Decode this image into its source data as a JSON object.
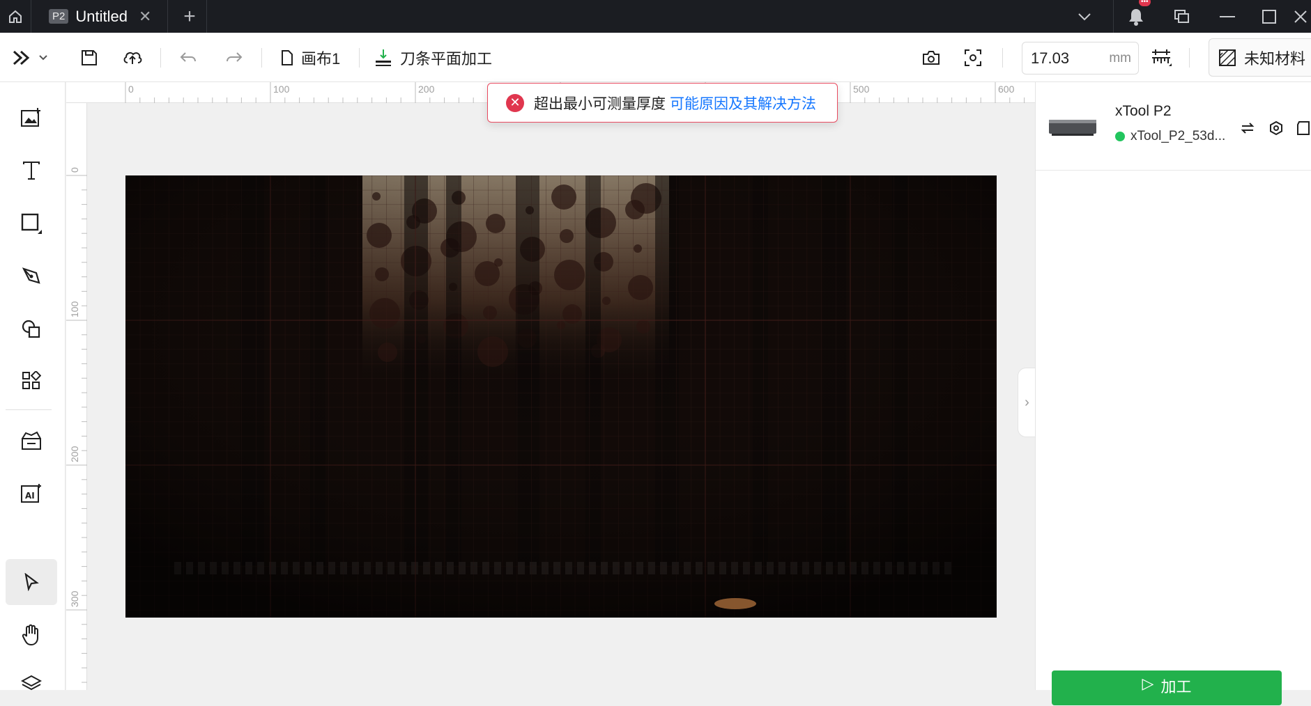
{
  "titlebar": {
    "tab_badge": "P2",
    "tab_title": "Untitled",
    "notification_count": "•••"
  },
  "toolbar": {
    "canvas_name": "画布1",
    "process_mode": "刀条平面加工",
    "thickness_value": "17.03",
    "thickness_unit": "mm",
    "material_label": "未知材料"
  },
  "rulers": {
    "top": [
      "0",
      "100",
      "200",
      "500",
      "600"
    ],
    "left": [
      "0",
      "100",
      "200",
      "300"
    ]
  },
  "toast": {
    "message": "超出最小可测量厚度",
    "link": "可能原因及其解决方法"
  },
  "device": {
    "name": "xTool P2",
    "id": "xTool_P2_53d...",
    "status_color": "#22c55e"
  },
  "process_button": {
    "label": "加工"
  },
  "colors": {
    "accent_green": "#22b14c",
    "error_red": "#e0364e",
    "link_blue": "#1677ff",
    "titlebar_bg": "#1b1d22"
  }
}
